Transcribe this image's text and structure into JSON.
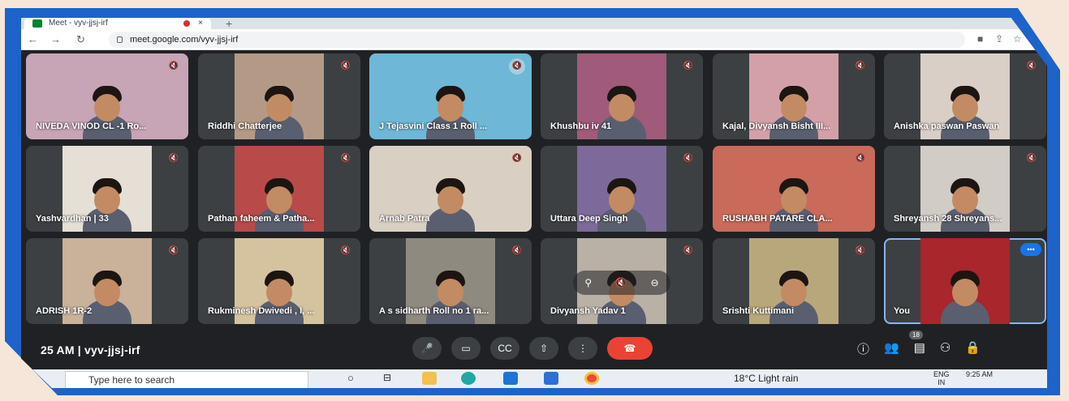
{
  "browser": {
    "tab_title": "Meet - vyv-jjsj-irf",
    "tab_close": "×",
    "new_tab": "+",
    "url": "meet.google.com/vyv-jjsj-irf"
  },
  "colors": {
    "frame": "#1d63c9",
    "tile": "#3c4043",
    "end_call": "#ea4335",
    "bg": "#202124"
  },
  "participants": [
    {
      "name": "NIVEDA VINOD CL -1 Ro...",
      "bg": "#c7a4b6",
      "muted": true
    },
    {
      "name": "Riddhi Chatterjee",
      "bg": "#b49a86",
      "muted": true
    },
    {
      "name": "J Tejasvini Class 1 Roll ...",
      "bg": "#6eb7d6",
      "muted": true
    },
    {
      "name": "Khushbu iv 41",
      "bg": "#a05a7a",
      "muted": true
    },
    {
      "name": "Kajal, Divyansh Bisht III...",
      "bg": "#d4a0a8",
      "muted": true
    },
    {
      "name": "Anishka paswan Paswan",
      "bg": "#d9cfc6",
      "muted": true
    },
    {
      "name": "Yashvardhan | 33",
      "bg": "#e6dfd6",
      "muted": true
    },
    {
      "name": "Pathan faheem & Patha...",
      "bg": "#b84a4a",
      "muted": true
    },
    {
      "name": "Arnab Patra",
      "bg": "#d9d0c3",
      "muted": true
    },
    {
      "name": "Uttara Deep Singh",
      "bg": "#7d6a9a",
      "muted": true
    },
    {
      "name": "RUSHABH PATARE CLA...",
      "bg": "#c96a5a",
      "muted": true
    },
    {
      "name": "Shreyansh 28 Shreyans...",
      "bg": "#d2ccc6",
      "muted": true
    },
    {
      "name": "ADRISH 1R-2",
      "bg": "#c9b19a",
      "muted": true
    },
    {
      "name": "Rukminesh Dwivedi , I, ...",
      "bg": "#d4c39e",
      "muted": true
    },
    {
      "name": "A s sidharth Roll no 1 ra...",
      "bg": "#8f8a80",
      "muted": true
    },
    {
      "name": "Divyansh Yadav 1",
      "bg": "#b9b0a6",
      "muted": true
    },
    {
      "name": "Srishti Kuttimani",
      "bg": "#b9a77c",
      "muted": true
    },
    {
      "name": "You",
      "bg": "#a8262c",
      "muted": false
    }
  ],
  "hover_controls": {
    "pin": "⚲",
    "mute": "🔇",
    "remove": "⊖"
  },
  "bottom_bar": {
    "meeting_info": "25 AM  |  vyv-jjsj-irf",
    "participant_count": "18",
    "controls": [
      "🎤",
      "▭",
      "CC",
      "⇧",
      "⋮",
      "☎"
    ],
    "right_controls": [
      "ⓘ",
      "👥",
      "▤",
      "⚇",
      "🔒"
    ]
  },
  "taskbar": {
    "search_placeholder": "Type here to search",
    "weather": "18°C  Light rain",
    "language": "ENG",
    "language_region": "IN",
    "time": "9:25 AM"
  }
}
